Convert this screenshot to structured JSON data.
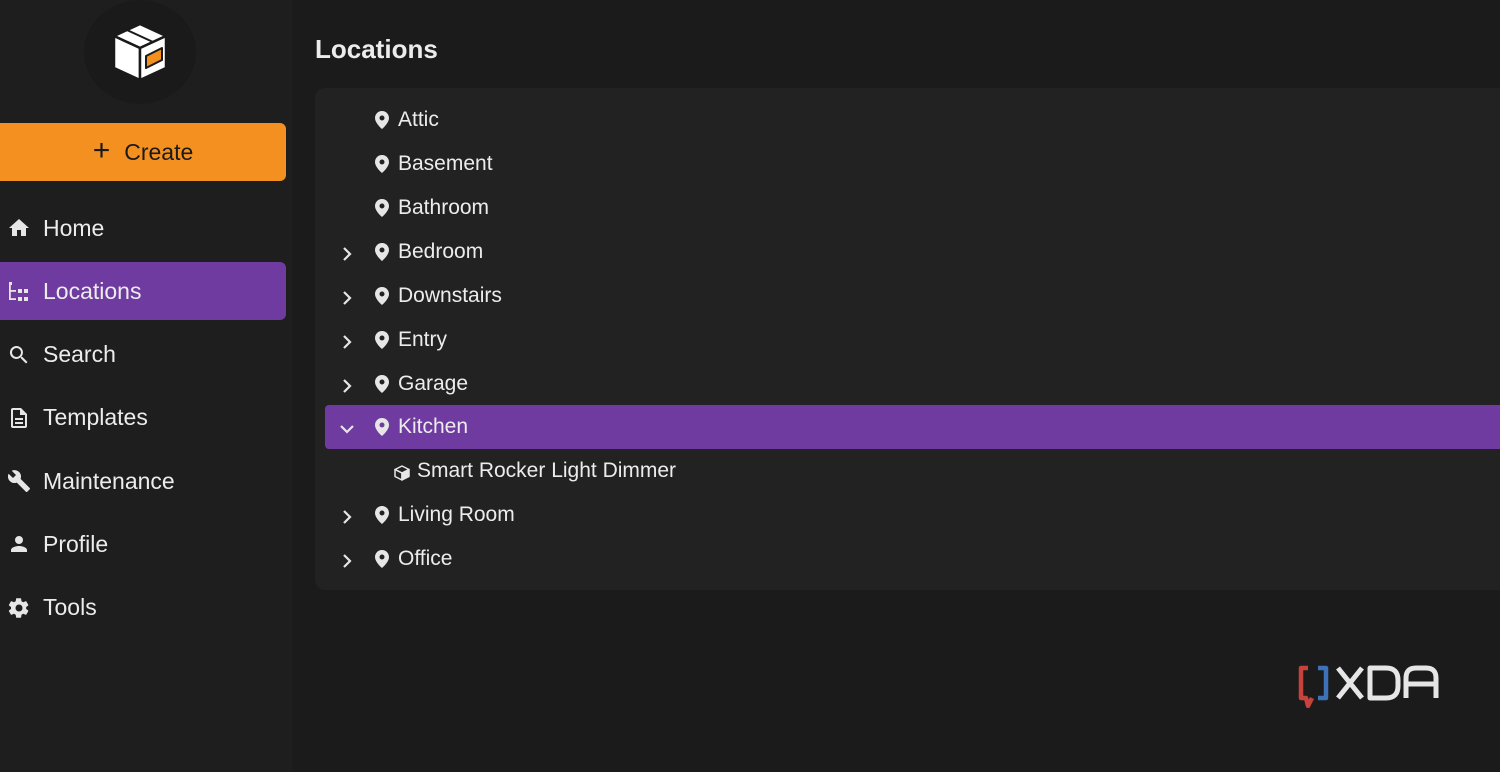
{
  "sidebar": {
    "create_label": "Create",
    "nav": [
      {
        "label": "Home",
        "icon": "home-icon"
      },
      {
        "label": "Locations",
        "icon": "tree-icon",
        "active": true
      },
      {
        "label": "Search",
        "icon": "search-icon"
      },
      {
        "label": "Templates",
        "icon": "document-icon"
      },
      {
        "label": "Maintenance",
        "icon": "wrench-icon"
      },
      {
        "label": "Profile",
        "icon": "user-icon"
      },
      {
        "label": "Tools",
        "icon": "gear-icon"
      }
    ]
  },
  "main": {
    "title": "Locations",
    "tree": [
      {
        "label": "Attic",
        "expandable": false
      },
      {
        "label": "Basement",
        "expandable": false
      },
      {
        "label": "Bathroom",
        "expandable": false
      },
      {
        "label": "Bedroom",
        "expandable": true
      },
      {
        "label": "Downstairs",
        "expandable": true
      },
      {
        "label": "Entry",
        "expandable": true
      },
      {
        "label": "Garage",
        "expandable": true
      },
      {
        "label": "Kitchen",
        "expandable": true,
        "expanded": true,
        "active": true,
        "children": [
          {
            "label": "Smart Rocker Light Dimmer",
            "icon": "cube-icon"
          }
        ]
      },
      {
        "label": "Living Room",
        "expandable": true
      },
      {
        "label": "Office",
        "expandable": true
      }
    ]
  },
  "colors": {
    "accent_purple": "#6f3ba1",
    "create_orange": "#f4901f",
    "background": "#1b1b1b",
    "panel": "#222222"
  }
}
